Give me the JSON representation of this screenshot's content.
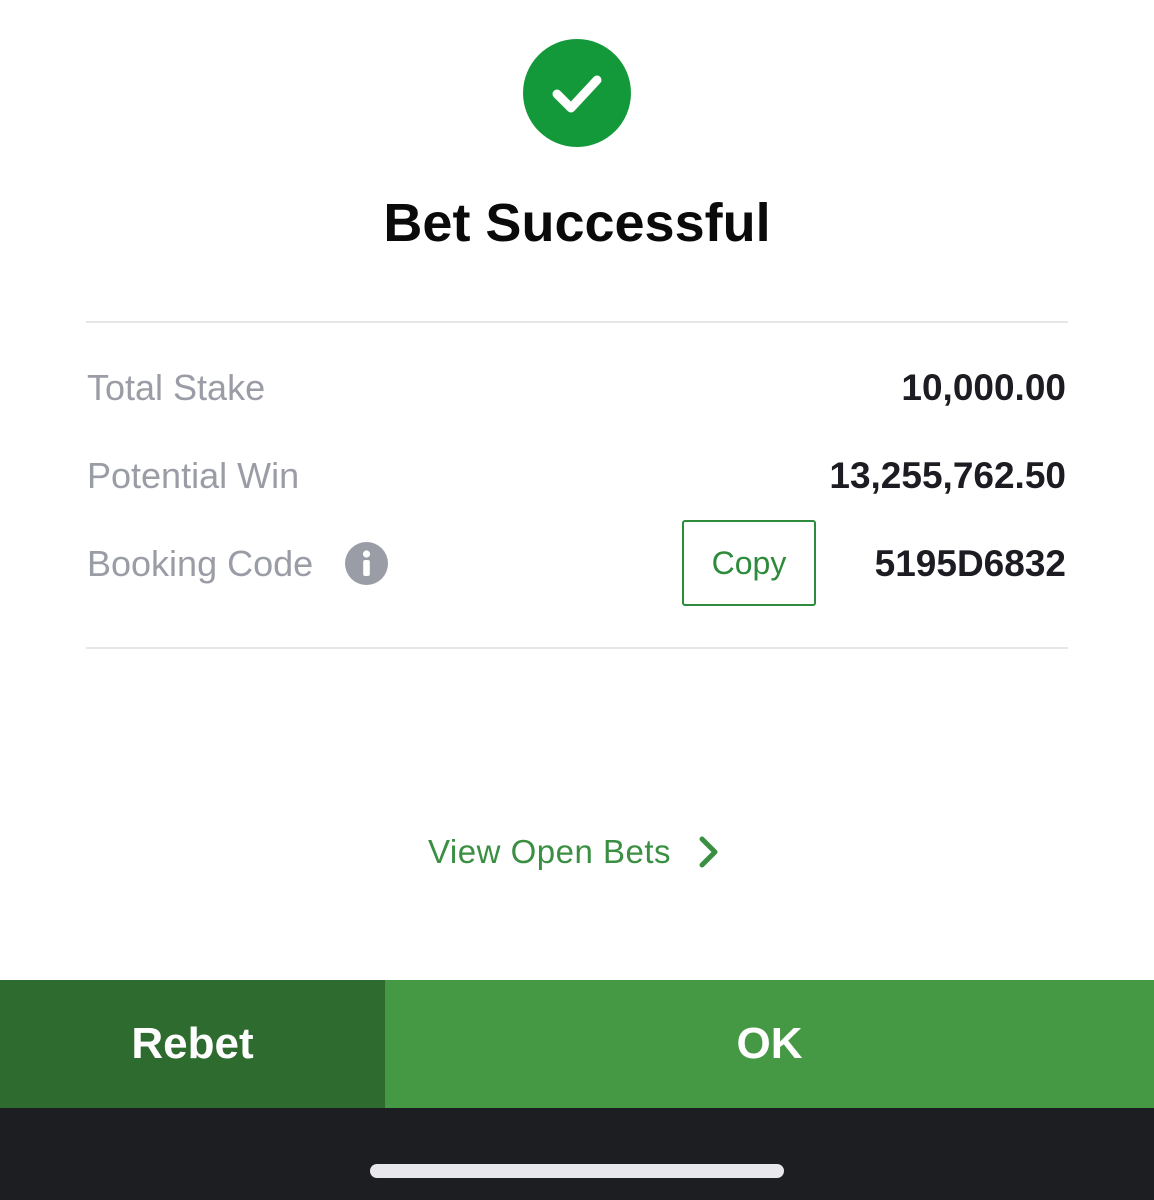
{
  "colors": {
    "success_green": "#14993a",
    "accent_green": "#2e8b3c",
    "rebet_bg": "#2e6b2e",
    "ok_bg": "#469944",
    "label_gray": "#9a9ca6",
    "bottom_bar": "#1d1e22"
  },
  "icons": {
    "status": "check-circle-icon",
    "booking_info": "info-icon",
    "link_arrow": "chevron-right-icon"
  },
  "header": {
    "title": "Bet Successful"
  },
  "summary": {
    "total_stake_label": "Total Stake",
    "total_stake_value": "10,000.00",
    "potential_win_label": "Potential Win",
    "potential_win_value": "13,255,762.50",
    "booking_code_label": "Booking Code",
    "booking_code_value": "5195D6832",
    "copy_label": "Copy"
  },
  "links": {
    "view_open_bets": "View Open Bets"
  },
  "actions": {
    "rebet_label": "Rebet",
    "ok_label": "OK"
  }
}
